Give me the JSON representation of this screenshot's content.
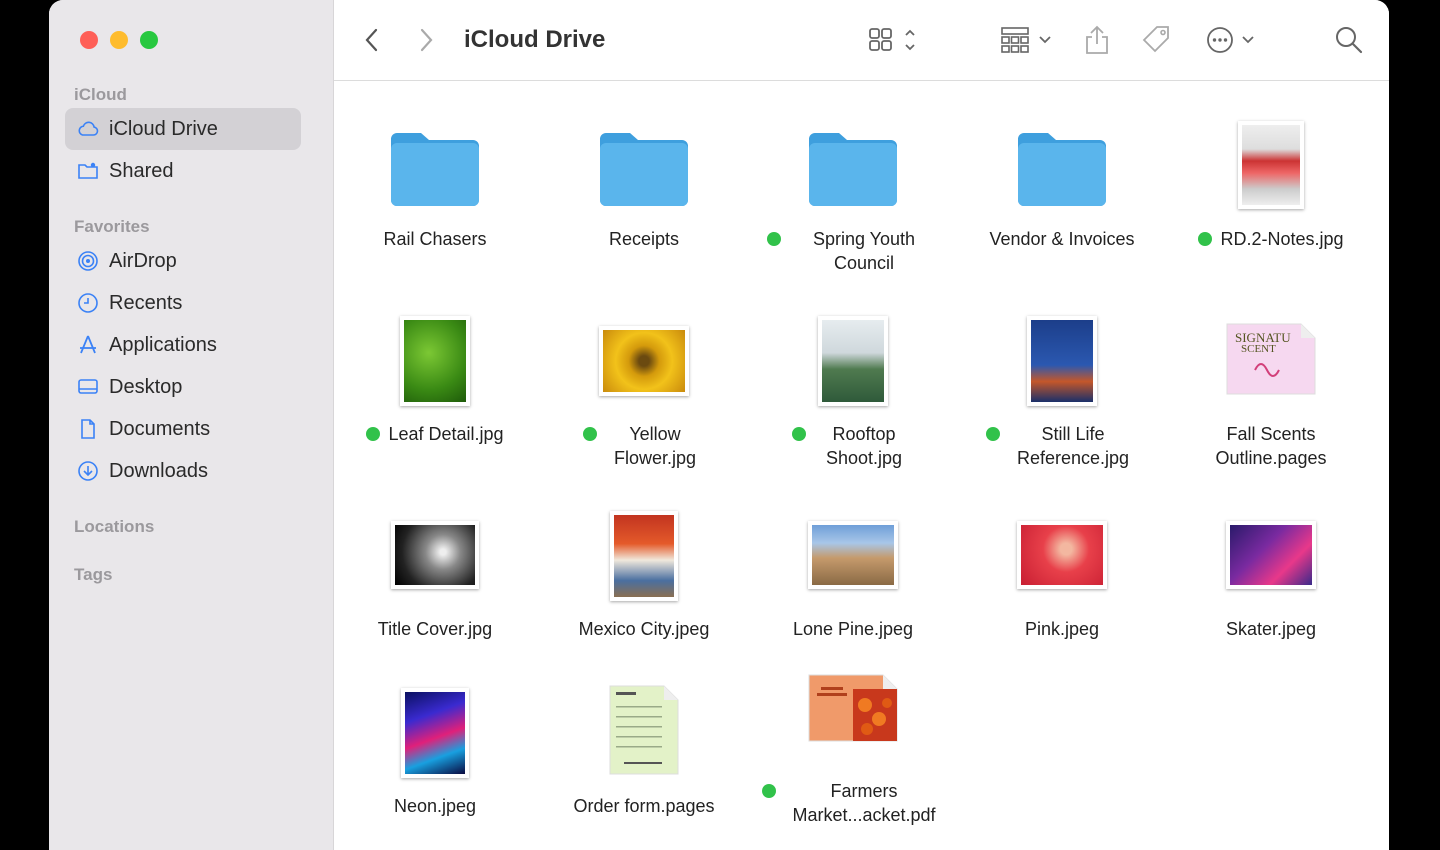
{
  "window": {
    "title": "iCloud Drive"
  },
  "sidebar": {
    "sections": [
      {
        "label": "iCloud"
      },
      {
        "label": "Favorites"
      },
      {
        "label": "Locations"
      },
      {
        "label": "Tags"
      }
    ],
    "items": [
      {
        "label": "iCloud Drive",
        "icon": "cloud-icon",
        "selected": true
      },
      {
        "label": "Shared",
        "icon": "shared-folder-icon"
      },
      {
        "label": "AirDrop",
        "icon": "airdrop-icon"
      },
      {
        "label": "Recents",
        "icon": "clock-icon"
      },
      {
        "label": "Applications",
        "icon": "applications-icon"
      },
      {
        "label": "Desktop",
        "icon": "desktop-icon"
      },
      {
        "label": "Documents",
        "icon": "document-icon"
      },
      {
        "label": "Downloads",
        "icon": "download-icon"
      }
    ]
  },
  "toolbar": {
    "back_icon": "chevron-left-icon",
    "forward_icon": "chevron-right-icon",
    "view_icon": "icon-view-grid-icon",
    "group_icon": "group-by-icon",
    "share_icon": "share-icon",
    "tag_icon": "tag-icon",
    "more_icon": "ellipsis-circle-icon",
    "search_icon": "search-icon"
  },
  "files": [
    {
      "name": "Rail Chasers",
      "kind": "folder",
      "tag": false
    },
    {
      "name": "Receipts",
      "kind": "folder",
      "tag": false
    },
    {
      "name": "Spring Youth Council",
      "kind": "folder",
      "tag": true
    },
    {
      "name": "Vendor & Invoices",
      "kind": "folder",
      "tag": false
    },
    {
      "name": "RD.2-Notes.jpg",
      "kind": "image",
      "tag": true
    },
    {
      "name": "Leaf Detail.jpg",
      "kind": "image",
      "tag": true
    },
    {
      "name": "Yellow Flower.jpg",
      "kind": "image",
      "tag": true
    },
    {
      "name": "Rooftop Shoot.jpg",
      "kind": "image",
      "tag": true
    },
    {
      "name": "Still Life Reference.jpg",
      "kind": "image",
      "tag": true
    },
    {
      "name": "Fall Scents Outline.pages",
      "kind": "pages",
      "tag": false
    },
    {
      "name": "Title Cover.jpg",
      "kind": "image",
      "tag": false
    },
    {
      "name": "Mexico City.jpeg",
      "kind": "image",
      "tag": false
    },
    {
      "name": "Lone Pine.jpeg",
      "kind": "image",
      "tag": false
    },
    {
      "name": "Pink.jpeg",
      "kind": "image",
      "tag": false
    },
    {
      "name": "Skater.jpeg",
      "kind": "image",
      "tag": false
    },
    {
      "name": "Neon.jpeg",
      "kind": "image",
      "tag": false
    },
    {
      "name": "Order form.pages",
      "kind": "pages",
      "tag": false
    },
    {
      "name": "Farmers Market...acket.pdf",
      "kind": "pdf",
      "tag": true
    }
  ],
  "colors": {
    "folder": "#5ab5ec",
    "tag_green": "#31c24a",
    "sidebar_bg": "#e9e7ea",
    "accent": "#3b82f6"
  }
}
